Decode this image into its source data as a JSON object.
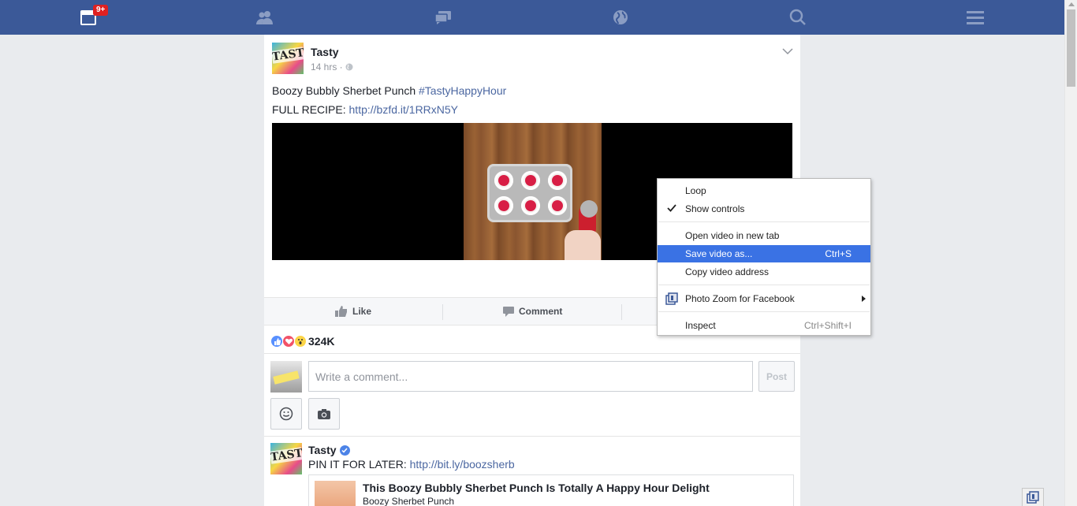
{
  "nav": {
    "notification_badge": "9+",
    "items": [
      "home-icon",
      "friends-icon",
      "messages-icon",
      "globe-icon",
      "search-icon",
      "menu-icon"
    ]
  },
  "post": {
    "author": "Tasty",
    "avatar_text": "TASTY",
    "time": "14 hrs ·",
    "title_text": "Boozy Bubbly Sherbet Punch ",
    "hashtag": "#TastyHappyHour",
    "recipe_label": "FULL RECIPE: ",
    "recipe_link": "http://bzfd.it/1RRxN5Y",
    "actions": {
      "like": "Like",
      "comment": "Comment"
    },
    "reactions": {
      "count": "324K"
    },
    "comment": {
      "placeholder": "Write a comment...",
      "post_button": "Post"
    }
  },
  "shared": {
    "author": "Tasty",
    "avatar_text": "TASTY",
    "text_label": "PIN IT FOR LATER: ",
    "link": "http://bit.ly/boozsherb",
    "card_title": "This Boozy Bubbly Sherbet Punch Is Totally A Happy Hour Delight",
    "card_subtitle": "Boozy Sherbet Punch"
  },
  "context_menu": {
    "loop": "Loop",
    "show_controls": "Show controls",
    "open_new_tab": "Open video in new tab",
    "save_as": "Save video as...",
    "save_shortcut": "Ctrl+S",
    "copy_address": "Copy video address",
    "photo_zoom": "Photo Zoom for Facebook",
    "inspect": "Inspect",
    "inspect_shortcut": "Ctrl+Shift+I"
  },
  "colors": {
    "nav_bg": "#3b5998",
    "link": "#4b67a1",
    "menu_highlight": "#3a72e4"
  }
}
